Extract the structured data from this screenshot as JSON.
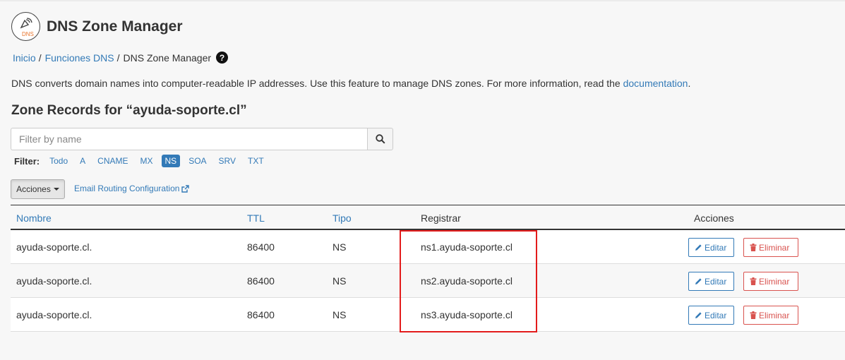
{
  "header": {
    "logo_text": "DNS",
    "title": "DNS Zone Manager"
  },
  "breadcrumb": {
    "items": [
      "Inicio",
      "Funciones DNS",
      "DNS Zone Manager"
    ],
    "separator": "/"
  },
  "description": {
    "text": "DNS converts domain names into computer-readable IP addresses. Use this feature to manage DNS zones. For more information, read the ",
    "link": "documentation",
    "end": "."
  },
  "zone_title": "Zone Records for “ayuda-soporte.cl”",
  "search": {
    "placeholder": "Filter by name",
    "value": ""
  },
  "filters": {
    "label": "Filter:",
    "items": [
      "Todo",
      "A",
      "CNAME",
      "MX",
      "NS",
      "SOA",
      "SRV",
      "TXT"
    ],
    "active": "NS"
  },
  "toolbar": {
    "actions_label": "Acciones",
    "email_routing_label": "Email Routing Configuration"
  },
  "table": {
    "headers": {
      "name": "Nombre",
      "ttl": "TTL",
      "type": "Tipo",
      "record": "Registrar",
      "actions": "Acciones"
    },
    "rows": [
      {
        "name": "ayuda-soporte.cl.",
        "ttl": "86400",
        "type": "NS",
        "record": "ns1.ayuda-soporte.cl",
        "edit": "Editar",
        "delete": "Eliminar"
      },
      {
        "name": "ayuda-soporte.cl.",
        "ttl": "86400",
        "type": "NS",
        "record": "ns2.ayuda-soporte.cl",
        "edit": "Editar",
        "delete": "Eliminar"
      },
      {
        "name": "ayuda-soporte.cl.",
        "ttl": "86400",
        "type": "NS",
        "record": "ns3.ayuda-soporte.cl",
        "edit": "Editar",
        "delete": "Eliminar"
      }
    ]
  },
  "colors": {
    "link": "#337ab7",
    "danger": "#d9534f",
    "highlight": "#e31b1b",
    "logo_accent": "#e8742b"
  },
  "icons": [
    "dns-logo-icon",
    "question-circle-icon",
    "search-icon",
    "caret-down-icon",
    "external-link-icon",
    "pencil-icon",
    "trash-icon"
  ]
}
